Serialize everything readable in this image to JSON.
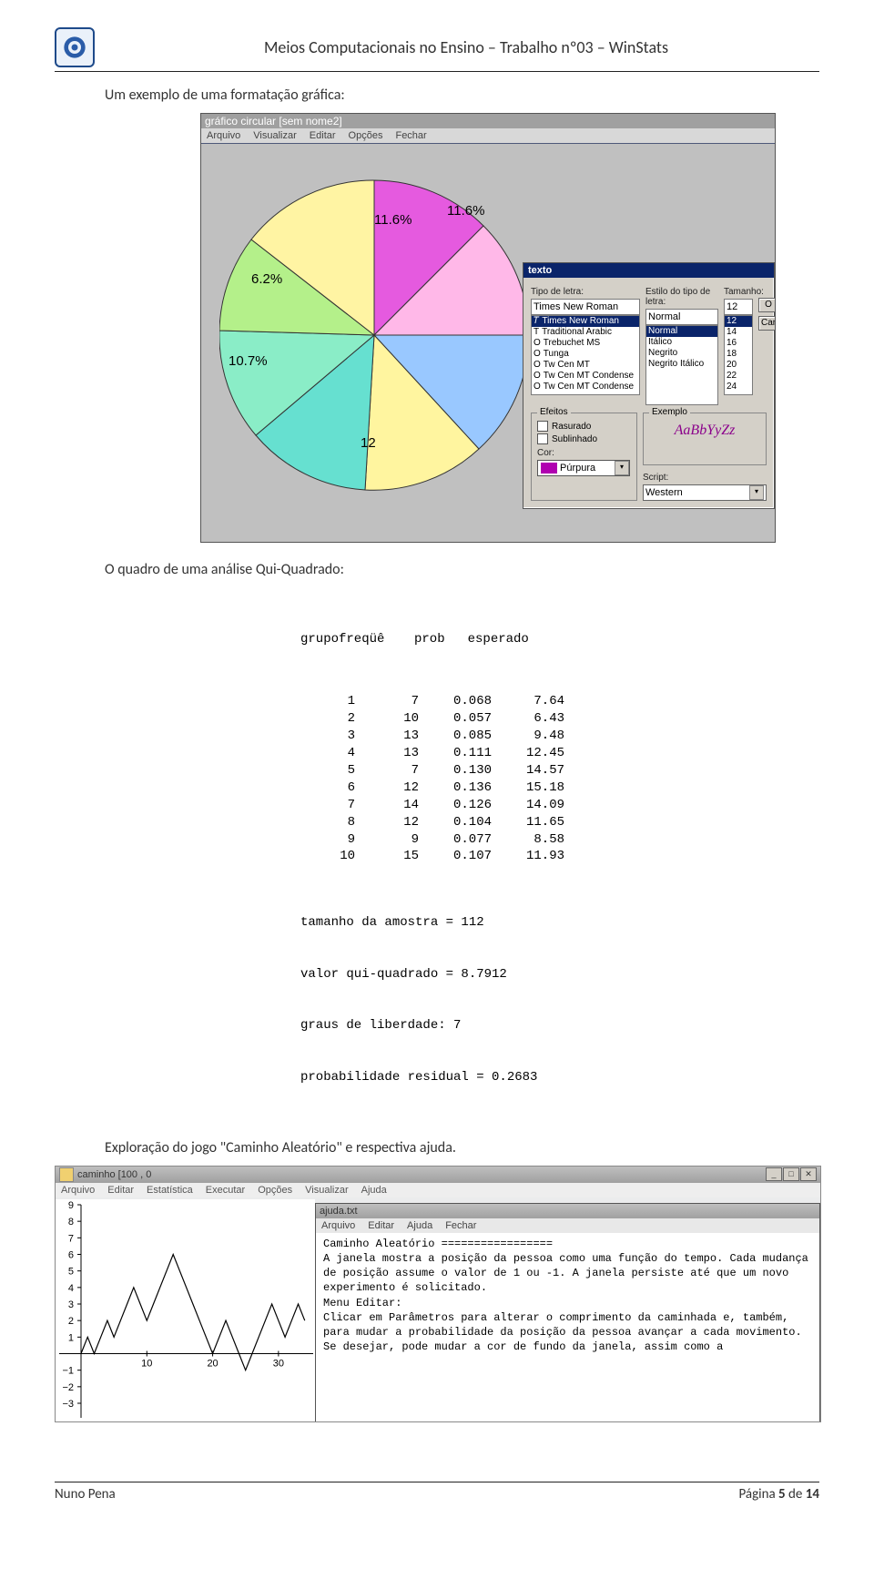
{
  "header": {
    "title": "Meios Computacionais no Ensino – Trabalho nº03 – WinStats"
  },
  "body": {
    "p1": "Um exemplo de uma formatação gráfica:",
    "p2": "O quadro de uma análise Qui-Quadrado:",
    "p3": "Exploração do jogo \"Caminho Aleatório\" e respectiva ajuda."
  },
  "ss1": {
    "title": "gráfico circular [sem nome2]",
    "menu": [
      "Arquivo",
      "Visualizar",
      "Editar",
      "Opções",
      "Fechar"
    ],
    "pie_labels": {
      "a": "11.6%",
      "b": "11.6%",
      "c": "6.2%",
      "d": "10.7%",
      "e": "12"
    },
    "dialog": {
      "title": "texto",
      "lbl_font": "Tipo de letra:",
      "lbl_style": "Estilo do tipo de letra:",
      "lbl_size": "Tamanho:",
      "font_value": "Times New Roman",
      "style_value": "Normal",
      "size_value": "12",
      "fonts": [
        "Times New Roman",
        "Traditional Arabic",
        "Trebuchet MS",
        "Tunga",
        "Tw Cen MT",
        "Tw Cen MT Condense",
        "Tw Cen MT Condense"
      ],
      "styles": [
        "Normal",
        "Itálico",
        "Negrito",
        "Negrito Itálico"
      ],
      "sizes": [
        "12",
        "14",
        "16",
        "18",
        "20",
        "22",
        "24"
      ],
      "btn_ok": "O",
      "btn_cancel": "Can",
      "grp_effects": "Efeitos",
      "chk_strike": "Rasurado",
      "chk_under": "Sublinhado",
      "lbl_color": "Cor:",
      "color_name": "Púrpura",
      "grp_sample": "Exemplo",
      "sample": "AaBbYyZz",
      "lbl_script": "Script:",
      "script_value": "Western"
    }
  },
  "qq": {
    "h1": "grupofreqüê",
    "h2": "prob",
    "h3": "esperado",
    "rows": [
      {
        "i": "1",
        "f": "7",
        "p": "0.068",
        "e": "7.64"
      },
      {
        "i": "2",
        "f": "10",
        "p": "0.057",
        "e": "6.43"
      },
      {
        "i": "3",
        "f": "13",
        "p": "0.085",
        "e": "9.48"
      },
      {
        "i": "4",
        "f": "13",
        "p": "0.111",
        "e": "12.45"
      },
      {
        "i": "5",
        "f": "7",
        "p": "0.130",
        "e": "14.57"
      },
      {
        "i": "6",
        "f": "12",
        "p": "0.136",
        "e": "15.18"
      },
      {
        "i": "7",
        "f": "14",
        "p": "0.126",
        "e": "14.09"
      },
      {
        "i": "8",
        "f": "12",
        "p": "0.104",
        "e": "11.65"
      },
      {
        "i": "9",
        "f": "9",
        "p": "0.077",
        "e": "8.58"
      },
      {
        "i": "10",
        "f": "15",
        "p": "0.107",
        "e": "11.93"
      }
    ],
    "l1": "tamanho da amostra = 112",
    "l2": "valor qui-quadrado = 8.7912",
    "l3": "graus de liberdade: 7",
    "l4": "probabilidade residual = 0.2683"
  },
  "ss3": {
    "title": "caminho [100 , 0",
    "menu": [
      "Arquivo",
      "Editar",
      "Estatística",
      "Executar",
      "Opções",
      "Visualizar",
      "Ajuda"
    ],
    "yticks": [
      "9",
      "8",
      "7",
      "6",
      "5",
      "4",
      "3",
      "2",
      "1",
      "−1",
      "−2",
      "−3"
    ],
    "xticks": [
      "10",
      "20",
      "30"
    ],
    "help_title": "ajuda.txt",
    "help_menu": [
      "Arquivo",
      "Editar",
      "Ajuda",
      "Fechar"
    ],
    "help_l1": "Caminho Aleatório",
    "help_l2": "=================",
    "help_p1": "A janela mostra a posição da pessoa como uma função do tempo. Cada mudança de posição assume o valor de 1 ou -1. A janela persiste até que um novo experimento é solicitado.",
    "help_h2": "Menu Editar:",
    "help_p2": "Clicar em Parâmetros para alterar o comprimento da caminhada e, também, para mudar a probabilidade da posição da pessoa avançar a cada movimento.",
    "help_p3": "Se desejar, pode mudar a cor de fundo da janela, assim como a"
  },
  "chart_data": [
    {
      "type": "pie",
      "title": "gráfico circular",
      "visible_labels": [
        "11.6%",
        "11.6%",
        "6.2%",
        "10.7%",
        "12"
      ],
      "slices": [
        {
          "label": "11.6%",
          "value": 11.6,
          "color": "#e55adf"
        },
        {
          "label": "11.6%",
          "value": 11.6,
          "color": "#ffb8e8"
        },
        {
          "value": 12.0,
          "color": "#99c8ff"
        },
        {
          "value": 12.0,
          "color": "#fff59f"
        },
        {
          "value": 12.5,
          "color": "#66e0d0"
        },
        {
          "label": "10.7%",
          "value": 10.7,
          "color": "#8aedc7"
        },
        {
          "label": "6.2%",
          "value": 6.2,
          "color": "#b4f08a"
        },
        {
          "value": 11.6,
          "color": "#fff4a3"
        }
      ]
    },
    {
      "type": "line",
      "title": "caminho [100,0]",
      "xlabel": "",
      "ylabel": "",
      "xlim": [
        0,
        35
      ],
      "ylim": [
        -3,
        9
      ],
      "x": [
        0,
        1,
        2,
        3,
        4,
        5,
        6,
        7,
        8,
        9,
        10,
        11,
        12,
        13,
        14,
        15,
        16,
        17,
        18,
        19,
        20,
        21,
        22,
        23,
        24,
        25,
        26,
        27,
        28,
        29,
        30,
        31,
        32,
        33,
        34
      ],
      "y": [
        0,
        1,
        0,
        1,
        2,
        1,
        2,
        3,
        4,
        3,
        2,
        3,
        4,
        5,
        6,
        5,
        4,
        3,
        2,
        1,
        0,
        1,
        2,
        1,
        0,
        -1,
        0,
        1,
        2,
        3,
        2,
        1,
        2,
        3,
        2
      ]
    }
  ],
  "footer": {
    "author": "Nuno Pena",
    "page_label": "Página ",
    "page_num": "5",
    "page_of": " de ",
    "page_total": "14"
  }
}
